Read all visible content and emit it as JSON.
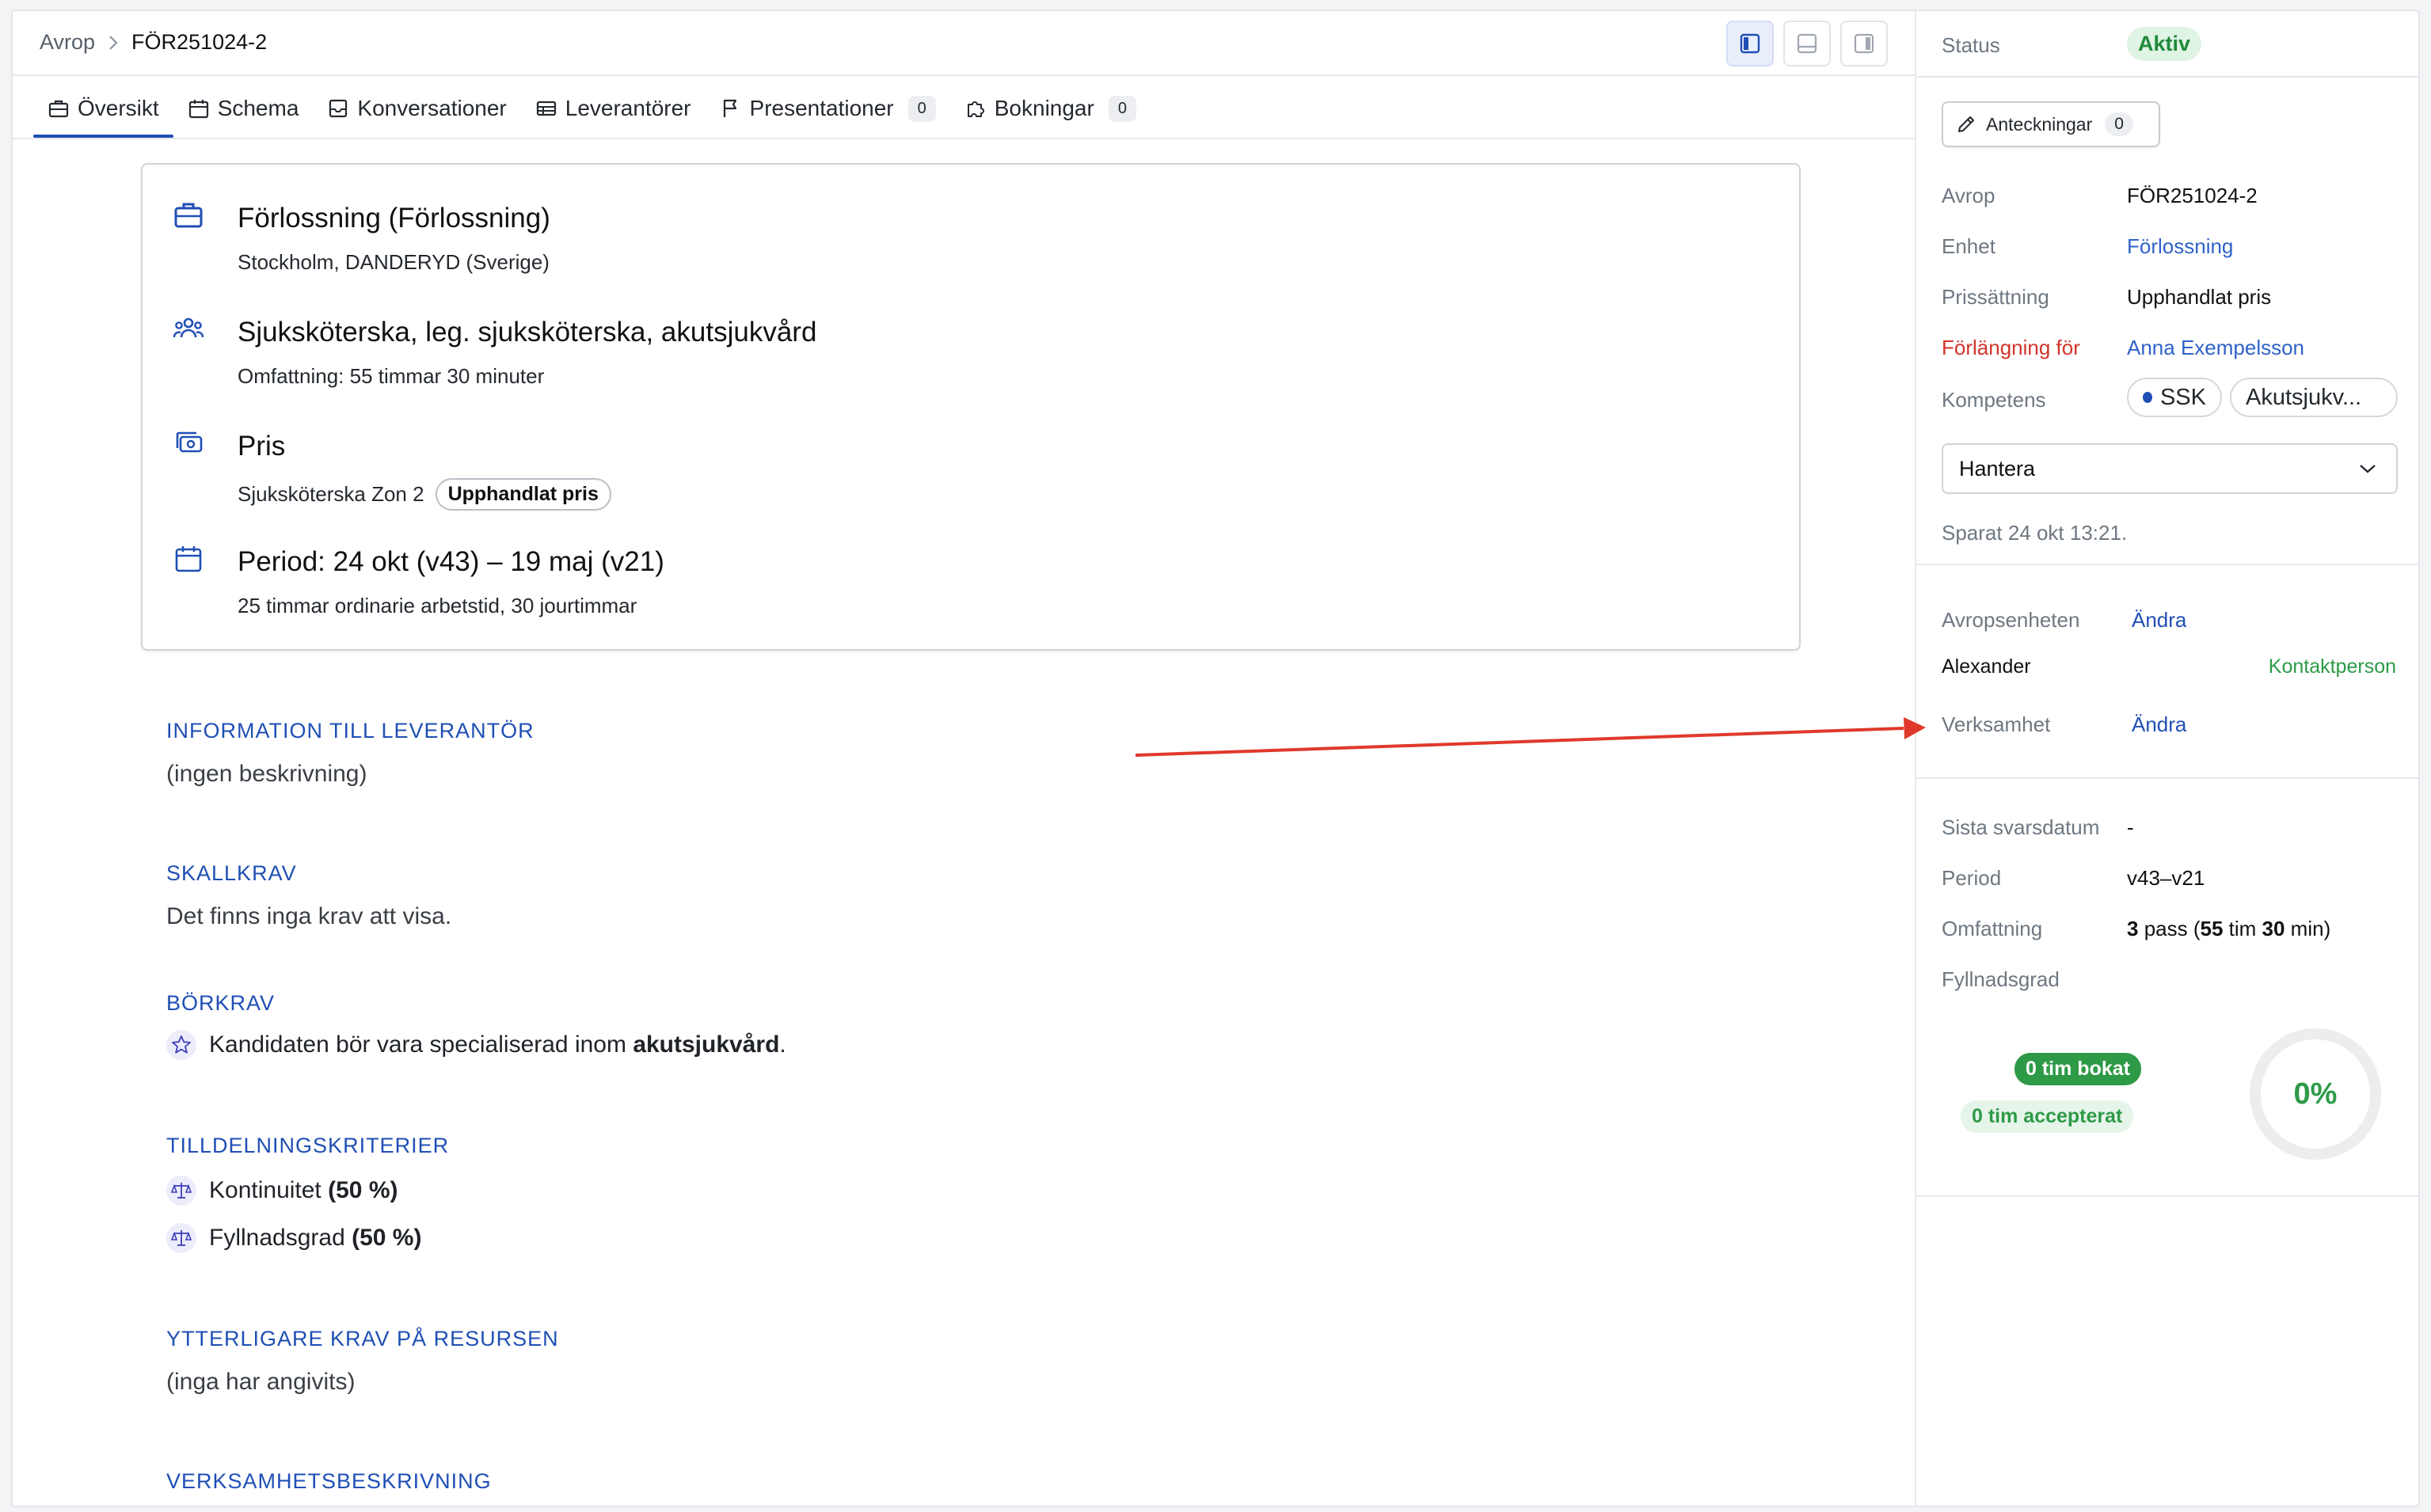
{
  "breadcrumb": {
    "root": "Avrop",
    "current": "FÖR251024-2"
  },
  "tabs": [
    {
      "label": "Översikt",
      "icon": "briefcase-icon",
      "badge": ""
    },
    {
      "label": "Schema",
      "icon": "calendar-icon",
      "badge": ""
    },
    {
      "label": "Konversationer",
      "icon": "inbox-icon",
      "badge": ""
    },
    {
      "label": "Leverantörer",
      "icon": "table-icon",
      "badge": ""
    },
    {
      "label": "Presentationer",
      "icon": "flag-icon",
      "badge": "0"
    },
    {
      "label": "Bokningar",
      "icon": "puzzle-icon",
      "badge": "0"
    }
  ],
  "summary": {
    "unit": {
      "title": "Förlossning (Förlossning)",
      "subtitle": "Stockholm, DANDERYD (Sverige)"
    },
    "role": {
      "title": "Sjuksköterska, leg. sjuksköterska, akutsjukvård",
      "subtitle": "Omfattning: 55 timmar 30 minuter"
    },
    "price": {
      "title": "Pris",
      "subtitle": "Sjuksköterska Zon 2",
      "badge": "Upphandlat pris"
    },
    "period": {
      "title": "Period: 24 okt (v43) – 19 maj (v21)",
      "subtitle": "25 timmar ordinarie arbetstid, 30 jourtimmar"
    }
  },
  "sections": {
    "info": {
      "title": "INFORMATION TILL LEVERANTÖR",
      "text": "(ingen beskrivning)"
    },
    "must": {
      "title": "SKALLKRAV",
      "text": "Det finns inga krav att visa."
    },
    "should": {
      "title": "BÖRKRAV",
      "text_prefix": "Kandidaten bör vara specialiserad inom ",
      "text_bold": "akutsjukvård",
      "text_suffix": "."
    },
    "criteria": {
      "title": "TILLDELNINGSKRITERIER",
      "items": [
        {
          "name": "Kontinuitet",
          "weight": "(50 %)"
        },
        {
          "name": "Fyllnadsgrad",
          "weight": "(50 %)"
        }
      ]
    },
    "extra": {
      "title": "YTTERLIGARE KRAV PÅ RESURSEN",
      "text": "(inga har angivits)"
    },
    "business": {
      "title": "VERKSAMHETSBESKRIVNING"
    }
  },
  "sidebar": {
    "status_label": "Status",
    "status_value": "Aktiv",
    "notes_label": "Anteckningar",
    "notes_count": "0",
    "fields": {
      "avrop": {
        "label": "Avrop",
        "value": "FÖR251024-2"
      },
      "enhet": {
        "label": "Enhet",
        "value": "Förlossning"
      },
      "pricing": {
        "label": "Prissättning",
        "value": "Upphandlat pris"
      },
      "extension": {
        "label": "Förlängning för",
        "value": "Anna Exempelsson"
      },
      "competence": {
        "label": "Kompetens",
        "chips": [
          "SSK",
          "Akutsjukv..."
        ]
      }
    },
    "manage_label": "Hantera",
    "saved_text": "Sparat 24 okt 13:21.",
    "contacts": {
      "unit_label": "Avropsenheten",
      "unit_action": "Ändra",
      "person_name": "Alexander",
      "person_role": "Kontaktperson",
      "business_label": "Verksamhet",
      "business_action": "Ändra"
    },
    "stats": {
      "deadline_label": "Sista svarsdatum",
      "deadline_value": "-",
      "period_label": "Period",
      "period_value": "v43–v21",
      "scope_label": "Omfattning",
      "scope_shifts": "3",
      "scope_shifts_unit": " pass (",
      "scope_hours": "55",
      "scope_hours_unit": " tim ",
      "scope_minutes": "30",
      "scope_minutes_unit": " min)",
      "fill_label": "Fyllnadsgrad",
      "booked": "0 tim bokat",
      "accepted": "0 tim accepterat",
      "fill_percent": "0%",
      "fill_value": 0
    }
  },
  "colors": {
    "accent": "#1f4fb5",
    "link": "#2f62c9",
    "success": "#2e9a47",
    "danger": "#d2342a",
    "annotation_arrow": "#e0392b"
  }
}
